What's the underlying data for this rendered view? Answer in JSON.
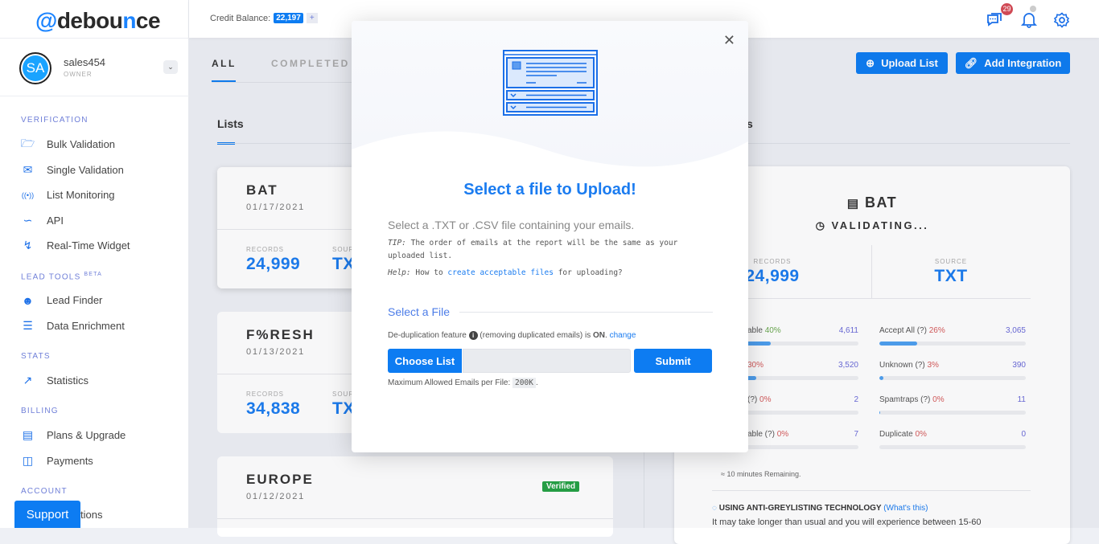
{
  "brand": {
    "logo": "@debounce",
    "accent": "#0d7cf2"
  },
  "user": {
    "initials": "SA",
    "name": "sales454",
    "role": "OWNER"
  },
  "sidebar": {
    "sections": [
      {
        "title": "VERIFICATION",
        "items": [
          {
            "label": "Bulk Validation",
            "icon": "folder-plus-icon"
          },
          {
            "label": "Single Validation",
            "icon": "envelope-at-icon"
          },
          {
            "label": "List Monitoring",
            "icon": "broadcast-icon"
          },
          {
            "label": "API",
            "icon": "api-icon"
          },
          {
            "label": "Real-Time Widget",
            "icon": "bolt-icon"
          }
        ]
      },
      {
        "title": "LEAD TOOLS",
        "sup": "BETA",
        "items": [
          {
            "label": "Lead Finder",
            "icon": "user-plus-icon"
          },
          {
            "label": "Data Enrichment",
            "icon": "clipboard-icon"
          }
        ]
      },
      {
        "title": "STATS",
        "items": [
          {
            "label": "Statistics",
            "icon": "chart-icon"
          }
        ]
      },
      {
        "title": "BILLING",
        "items": [
          {
            "label": "Plans & Upgrade",
            "icon": "inbox-icon"
          },
          {
            "label": "Payments",
            "icon": "wallet-icon"
          }
        ]
      },
      {
        "title": "ACCOUNT",
        "items": [
          {
            "label": "tions",
            "icon": "gear-icon"
          }
        ]
      }
    ],
    "support": "Support"
  },
  "topbar": {
    "credit_label": "Credit Balance:",
    "credit_value": "22,197",
    "credit_plus": "+",
    "messages_badge": "29"
  },
  "tabs": [
    {
      "label": "ALL",
      "active": true
    },
    {
      "label": "COMPLETED"
    }
  ],
  "actions": {
    "upload": "Upload List",
    "integration": "Add Integration"
  },
  "lists_tab": "Lists",
  "details_tab_fragment": "s",
  "lists": [
    {
      "title": "BAT",
      "date": "01/17/2021",
      "records_label": "RECORDS",
      "records": "24,999",
      "source_label": "SOUR",
      "source": "TX"
    },
    {
      "title": "F%RESH",
      "date": "01/13/2021",
      "records_label": "RECORDS",
      "records": "34,838",
      "source_label": "SOUR",
      "source": "TX"
    },
    {
      "title": "EUROPE",
      "date": "01/12/2021",
      "badge": "Verified"
    }
  ],
  "detail": {
    "title": "BAT",
    "status": "VALIDATING...",
    "records_label": "RECORDS",
    "records": "24,999",
    "source_label": "SOURCE",
    "source": "TXT",
    "stats": [
      {
        "label": "able",
        "pct": "40%",
        "count": "4,611",
        "fill": 40
      },
      {
        "label": "Accept All (?)",
        "pct": "26%",
        "count": "3,065",
        "fill": 26
      },
      {
        "label": "",
        "pct": "30%",
        "count": "3,520",
        "fill": 30
      },
      {
        "label": "Unknown (?)",
        "pct": "3%",
        "count": "390",
        "fill": 3
      },
      {
        "label": "(?)",
        "pct": "0%",
        "count": "2",
        "fill": 0
      },
      {
        "label": "Spamtraps (?)",
        "pct": "0%",
        "count": "11",
        "fill": 0.5
      },
      {
        "label": "able (?)",
        "pct": "0%",
        "count": "7",
        "fill": 0
      },
      {
        "label": "Duplicate",
        "pct": "0%",
        "count": "0",
        "fill": 0
      }
    ],
    "remaining": "≈ 10 minutes Remaining.",
    "grey_title": "USING ANTI-GREYLISTING TECHNOLOGY",
    "grey_link": "(What's this)",
    "grey_text": "It may take longer than usual and you will experience between 15-60"
  },
  "modal": {
    "title": "Select a file to Upload!",
    "desc": "Select a .TXT or .CSV file containing your emails.",
    "tip_label": "TIP:",
    "tip": "The order of emails at the report will be the same as your uploaded list.",
    "help_label": "Help:",
    "help_pre": "How to",
    "help_link": "create acceptable files",
    "help_post": "for uploading?",
    "section": "Select a File",
    "dedup_pre": "De-duplication feature",
    "dedup_mid": "(removing duplicated emails) is",
    "dedup_state": "ON",
    "dedup_link": "change",
    "choose": "Choose List",
    "file_value": "",
    "submit": "Submit",
    "max_label": "Maximum Allowed Emails per File:",
    "max_value": "200K"
  }
}
